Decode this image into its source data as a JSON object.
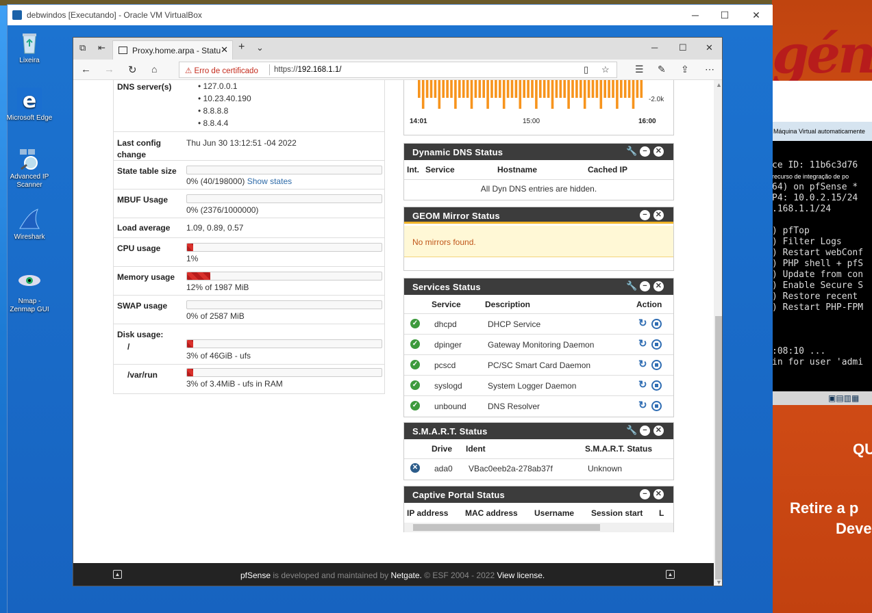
{
  "vbox": {
    "title": "debwindos [Executando] - Oracle VM VirtualBox"
  },
  "desktop": {
    "icons": [
      "Lixeira",
      "Microsoft Edge",
      "Advanced IP Scanner",
      "Wireshark",
      "Nmap - Zenmap GUI"
    ]
  },
  "browser": {
    "tab_title": "Proxy.home.arpa - Statu",
    "cert_warning": "Erro de certificado",
    "url_prefix": "https://",
    "url_host": "192.168.1.1/"
  },
  "sysinfo": {
    "dns_label": "DNS server(s)",
    "dns": [
      "127.0.0.1",
      "10.23.40.190",
      "8.8.8.8",
      "8.8.4.4"
    ],
    "lastcfg_label": "Last config change",
    "lastcfg_value": "Thu Jun 30 13:12:51 -04 2022",
    "state_label": "State table size",
    "state_value": "0% (40/198000)",
    "state_link": "Show states",
    "state_pct": 0,
    "mbuf_label": "MBUF Usage",
    "mbuf_value": "0% (2376/1000000)",
    "mbuf_pct": 0,
    "load_label": "Load average",
    "load_value": "1.09, 0.89, 0.57",
    "cpu_label": "CPU usage",
    "cpu_value": "1%",
    "cpu_pct": 1,
    "mem_label": "Memory usage",
    "mem_value": "12% of 1987 MiB",
    "mem_pct": 12,
    "swap_label": "SWAP usage",
    "swap_value": "0% of 2587 MiB",
    "swap_pct": 0,
    "disk_label": "Disk usage:",
    "disk_root_label": "/",
    "disk_root_value": "3% of 46GiB - ufs",
    "disk_root_pct": 3,
    "disk_var_label": "/var/run",
    "disk_var_value": "3% of 3.4MiB - ufs in RAM",
    "disk_var_pct": 3
  },
  "traffic": {
    "ylabel": "-2.0k",
    "x": [
      "14:01",
      "15:00",
      "16:00"
    ]
  },
  "ddns": {
    "title": "Dynamic DNS Status",
    "cols": [
      "Int.",
      "Service",
      "Hostname",
      "Cached IP"
    ],
    "message": "All Dyn DNS entries are hidden."
  },
  "geom": {
    "title": "GEOM Mirror Status",
    "message": "No mirrors found."
  },
  "services": {
    "title": "Services Status",
    "cols": [
      "Service",
      "Description",
      "Action"
    ],
    "rows": [
      {
        "name": "dhcpd",
        "desc": "DHCP Service"
      },
      {
        "name": "dpinger",
        "desc": "Gateway Monitoring Daemon"
      },
      {
        "name": "pcscd",
        "desc": "PC/SC Smart Card Daemon"
      },
      {
        "name": "syslogd",
        "desc": "System Logger Daemon"
      },
      {
        "name": "unbound",
        "desc": "DNS Resolver"
      }
    ]
  },
  "smart": {
    "title": "S.M.A.R.T. Status",
    "cols": [
      "Drive",
      "Ident",
      "S.M.A.R.T. Status"
    ],
    "row": {
      "drive": "ada0",
      "ident": "VBac0eeb2a-278ab37f",
      "status": "Unknown"
    }
  },
  "captive": {
    "title": "Captive Portal Status",
    "cols": [
      "IP address",
      "MAC address",
      "Username",
      "Session start",
      "L"
    ]
  },
  "footer": {
    "brand": "pfSense",
    "mid": " is developed and maintained by ",
    "company": "Netgate.",
    "copy": " © ESF 2004 - 2022 ",
    "license": "View license."
  },
  "right": {
    "logo": "génio",
    "strip": "Máquina Virtual automaticamente",
    "console": [
      "ce ID: 11b6c3d76",
      "recurso de integração de po",
      "64) on pfSense *",
      "",
      "P4: 10.0.2.15/24",
      ".168.1.1/24",
      "",
      ") pfTop",
      ") Filter Logs",
      ") Restart webConf",
      ") PHP shell + pfS",
      ") Update from con",
      ") Enable Secure S",
      ") Restore recent",
      ") Restart PHP-FPM",
      "",
      "",
      "",
      ":08:10 ...",
      "in for user 'admi"
    ],
    "q": "QU",
    "retire": "Retire a p",
    "deve": "Deve"
  }
}
